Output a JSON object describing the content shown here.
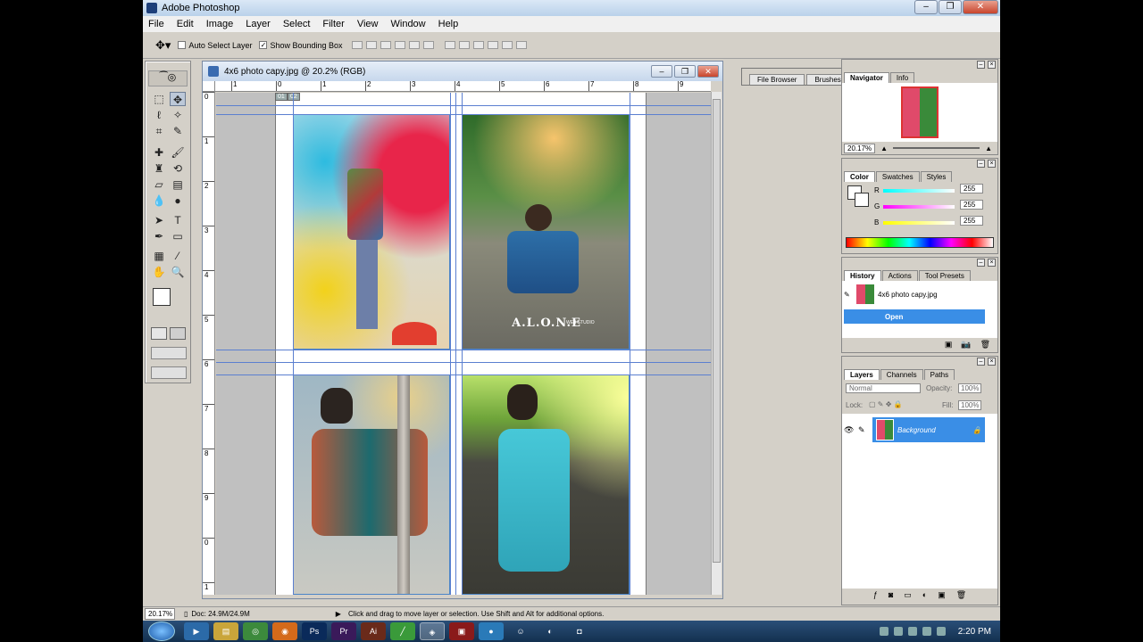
{
  "app": {
    "title": "Adobe Photoshop"
  },
  "menu": [
    "File",
    "Edit",
    "Image",
    "Layer",
    "Select",
    "Filter",
    "View",
    "Window",
    "Help"
  ],
  "options": {
    "auto_select": "Auto Select Layer",
    "show_bbox": "Show Bounding Box",
    "auto_select_checked": false,
    "show_bbox_checked": true
  },
  "palette_well": {
    "tabs": [
      "File Browser",
      "Brushes"
    ]
  },
  "document": {
    "title": "4x6 photo capy.jpg @ 20.2% (RGB)",
    "ruler_top": [
      "1",
      "0",
      "1",
      "2",
      "3",
      "4",
      "5",
      "6",
      "7",
      "8",
      "9"
    ],
    "ruler_left": [
      "0",
      "1",
      "2",
      "3",
      "4",
      "5",
      "6",
      "7",
      "8",
      "9",
      "0",
      "1"
    ],
    "slice_tags": [
      "01",
      "02"
    ],
    "photos": [
      {
        "name": "holi-boy",
        "text": ""
      },
      {
        "name": "alone-boy",
        "text": "A.L.O.N.E",
        "sub": "WEB STUDIO"
      },
      {
        "name": "jacket-boy",
        "text": ""
      },
      {
        "name": "railway-boy",
        "text": ""
      }
    ]
  },
  "navigator": {
    "tabs": [
      "Navigator",
      "Info"
    ],
    "zoom": "20.17%"
  },
  "color": {
    "tabs": [
      "Color",
      "Swatches",
      "Styles"
    ],
    "r_label": "R",
    "g_label": "G",
    "b_label": "B",
    "r": "255",
    "g": "255",
    "b": "255"
  },
  "history": {
    "tabs": [
      "History",
      "Actions",
      "Tool Presets"
    ],
    "snapshot": "4x6 photo capy.jpg",
    "states": [
      "Open"
    ]
  },
  "layers": {
    "tabs": [
      "Layers",
      "Channels",
      "Paths"
    ],
    "blend": "Normal",
    "opacity_label": "Opacity:",
    "opacity": "100%",
    "lock_label": "Lock:",
    "fill_label": "Fill:",
    "fill": "100%",
    "items": [
      {
        "name": "Background"
      }
    ]
  },
  "status": {
    "zoom": "20.17%",
    "doc": "Doc: 24.9M/24.9M",
    "hint": "Click and drag to move layer or selection.  Use Shift and Alt for additional options."
  },
  "taskbar": {
    "time": "2:20 PM"
  }
}
